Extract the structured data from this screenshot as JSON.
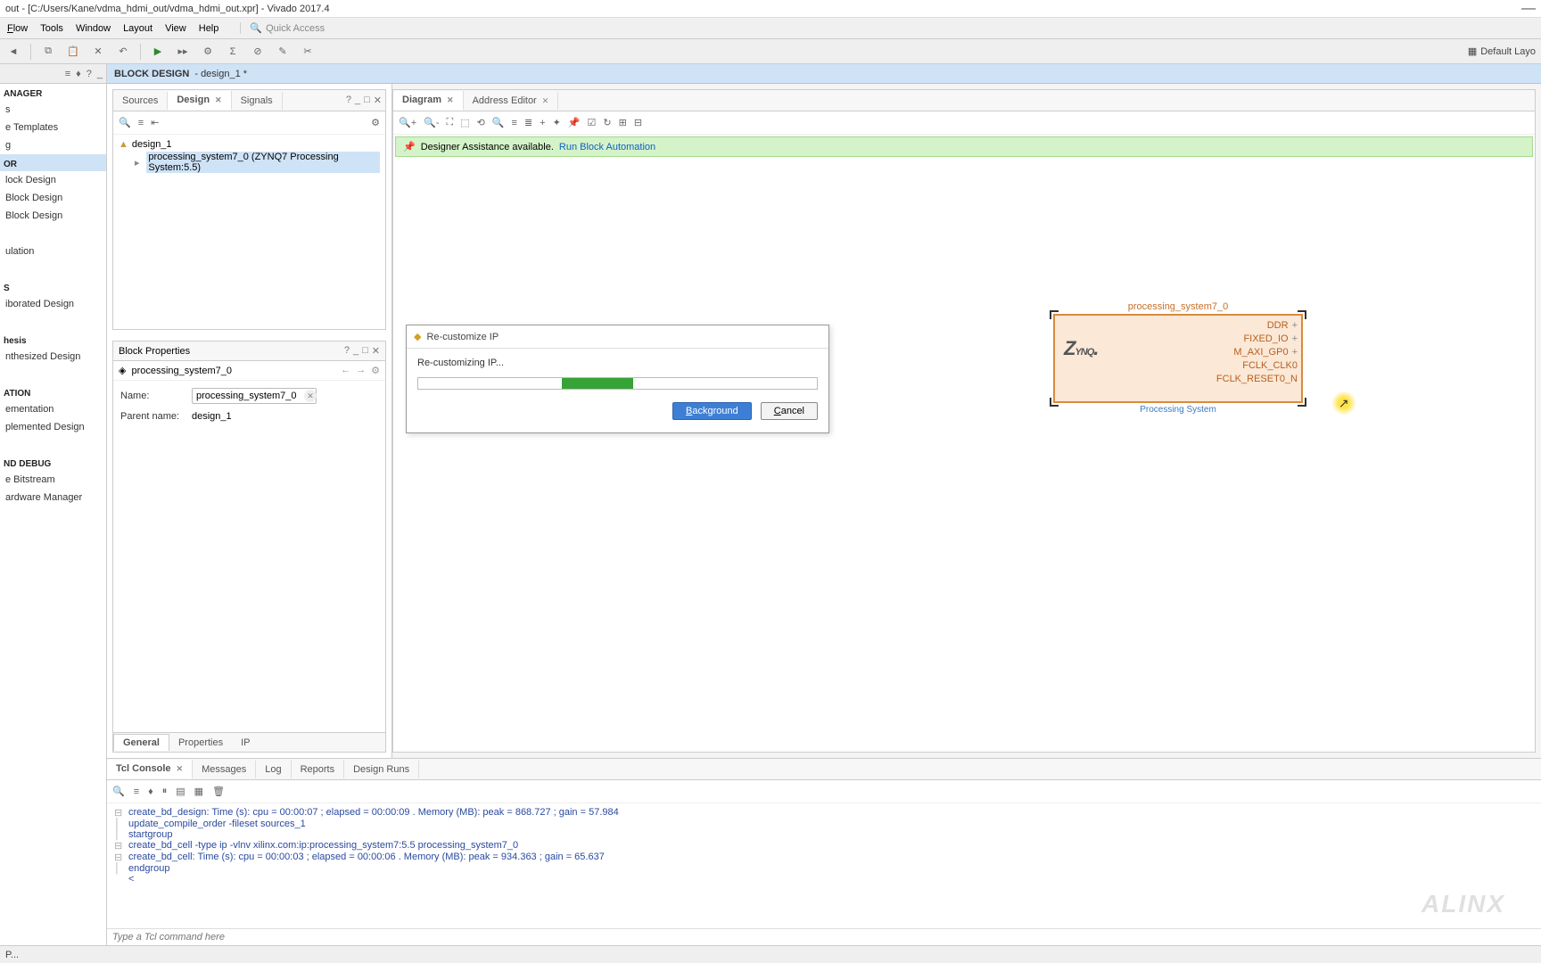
{
  "title": "out - [C:/Users/Kane/vdma_hdmi_out/vdma_hdmi_out.xpr] - Vivado 2017.4",
  "menus": {
    "flow": "Flow",
    "tools": "Tools",
    "window": "Window",
    "layout": "Layout",
    "view": "View",
    "help": "Help"
  },
  "quick": {
    "placeholder": "Quick Access"
  },
  "toolbar_right": "Default Layo",
  "nav": {
    "header": "ANAGER",
    "s1_items": [
      "s",
      "e Templates",
      "g"
    ],
    "s2": "OR",
    "s2_items": [
      "lock Design",
      "Block Design",
      " Block Design"
    ],
    "s3": "S",
    "s3_items": [
      "iborated Design"
    ],
    "s4": "hesis",
    "s4_items": [
      "nthesized Design"
    ],
    "s5": "ATION",
    "s5_items": [
      "ementation",
      "plemented Design"
    ],
    "s6": "ND DEBUG",
    "s6_items": [
      "e Bitstream",
      "ardware Manager"
    ]
  },
  "bd": {
    "label": "BLOCK DESIGN",
    "name": "- design_1 *"
  },
  "src_tabs": {
    "sources": "Sources",
    "design": "Design",
    "signals": "Signals"
  },
  "tree": {
    "root": "design_1",
    "child": "processing_system7_0 (ZYNQ7 Processing System:5.5)"
  },
  "props": {
    "title": "Block Properties",
    "obj": "processing_system7_0",
    "name_lbl": "Name:",
    "name_val": "processing_system7_0",
    "parent_lbl": "Parent name:",
    "parent_val": "design_1",
    "tabs": {
      "general": "General",
      "properties": "Properties",
      "ip": "IP"
    }
  },
  "diag_tabs": {
    "diagram": "Diagram",
    "addr": "Address Editor"
  },
  "assist": {
    "text": "Designer Assistance available.",
    "link": "Run Block Automation"
  },
  "ip": {
    "name": "processing_system7_0",
    "logo": "YNQ",
    "ports": [
      "DDR",
      "FIXED_IO",
      "M_AXI_GP0",
      "FCLK_CLK0",
      "FCLK_RESET0_N"
    ],
    "foot": "Processing System"
  },
  "dialog": {
    "title": "Re-customize IP",
    "msg": "Re-customizing IP...",
    "btn_bg": "Background",
    "btn_cancel": "Cancel"
  },
  "console_tabs": {
    "tcl": "Tcl Console",
    "msg": "Messages",
    "log": "Log",
    "rep": "Reports",
    "runs": "Design Runs"
  },
  "console_lines": [
    "create_bd_design: Time (s): cpu = 00:00:07 ; elapsed = 00:00:09 . Memory (MB): peak = 868.727 ; gain = 57.984",
    "update_compile_order -fileset sources_1",
    "startgroup",
    "create_bd_cell -type ip -vlnv xilinx.com:ip:processing_system7:5.5 processing_system7_0",
    "create_bd_cell: Time (s): cpu = 00:00:03 ; elapsed = 00:00:06 . Memory (MB): peak = 934.363 ; gain = 65.637",
    "endgroup"
  ],
  "console_input": "Type a Tcl command here",
  "status": "P...",
  "watermark": "ALINX"
}
